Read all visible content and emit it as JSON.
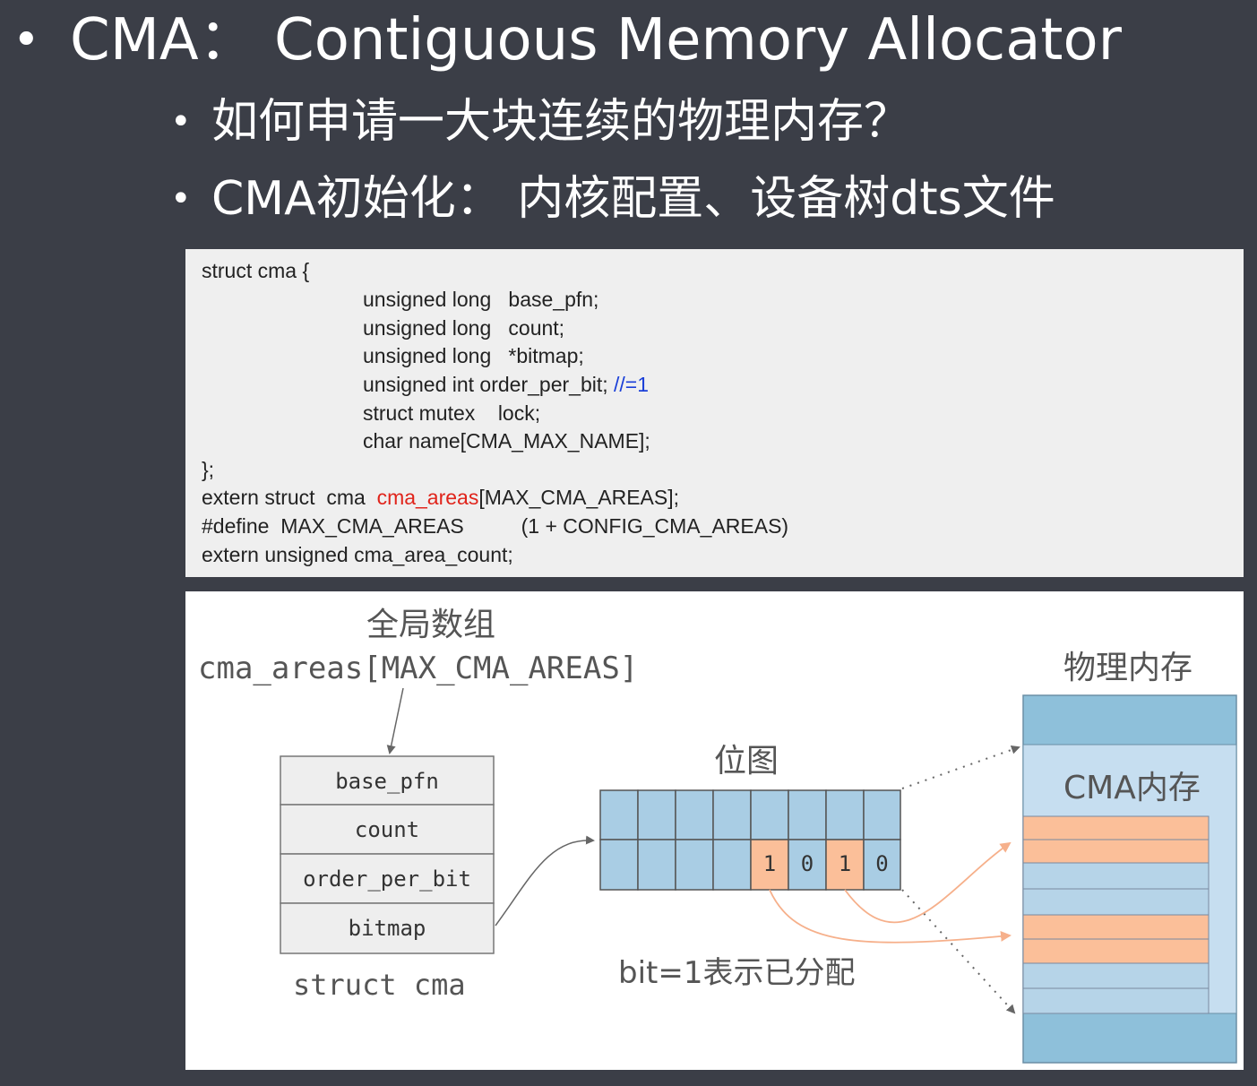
{
  "title": "CMA：  Contiguous Memory Allocator",
  "bullets": [
    "如何申请一大块连续的物理内存？",
    "CMA初始化：  内核配置、设备树dts文件"
  ],
  "code": {
    "l1": "struct cma {",
    "l2": "unsigned long   base_pfn;",
    "l3": "unsigned long   count;",
    "l4": "unsigned long   *bitmap;",
    "l5a": "unsigned int order_per_bit;",
    "l5b": " //=1",
    "l6": "struct mutex    lock;",
    "l7": "char name[CMA_MAX_NAME];",
    "l8": "};",
    "l9a": "extern struct  cma  ",
    "l9b": "cma_areas",
    "l9c": "[MAX_CMA_AREAS];",
    "l10": "#define  MAX_CMA_AREAS          (1 + CONFIG_CMA_AREAS)",
    "l11": "extern unsigned cma_area_count;"
  },
  "diagram": {
    "global_array_label": "全局数组",
    "array_name": "cma_areas[MAX_CMA_AREAS]",
    "struct_fields": [
      "base_pfn",
      "count",
      "order_per_bit",
      "bitmap"
    ],
    "struct_caption": "struct  cma",
    "bitmap_label": "位图",
    "bitmap_bits": [
      "1",
      "0",
      "1",
      "0"
    ],
    "bitmap_note": "bit=1表示已分配",
    "physical_memory_label": "物理内存",
    "cma_memory_label": "CMA内存"
  },
  "colors": {
    "background": "#3b3e47",
    "code_bg": "#efefef",
    "highlight_red": "#e0241b",
    "comment_blue": "#1a3fd8",
    "cell_blue": "#a9cde4",
    "memory_blue": "#8ec0da",
    "allocated_orange": "#fbbf99",
    "arrow_orange": "#f6b08b"
  }
}
